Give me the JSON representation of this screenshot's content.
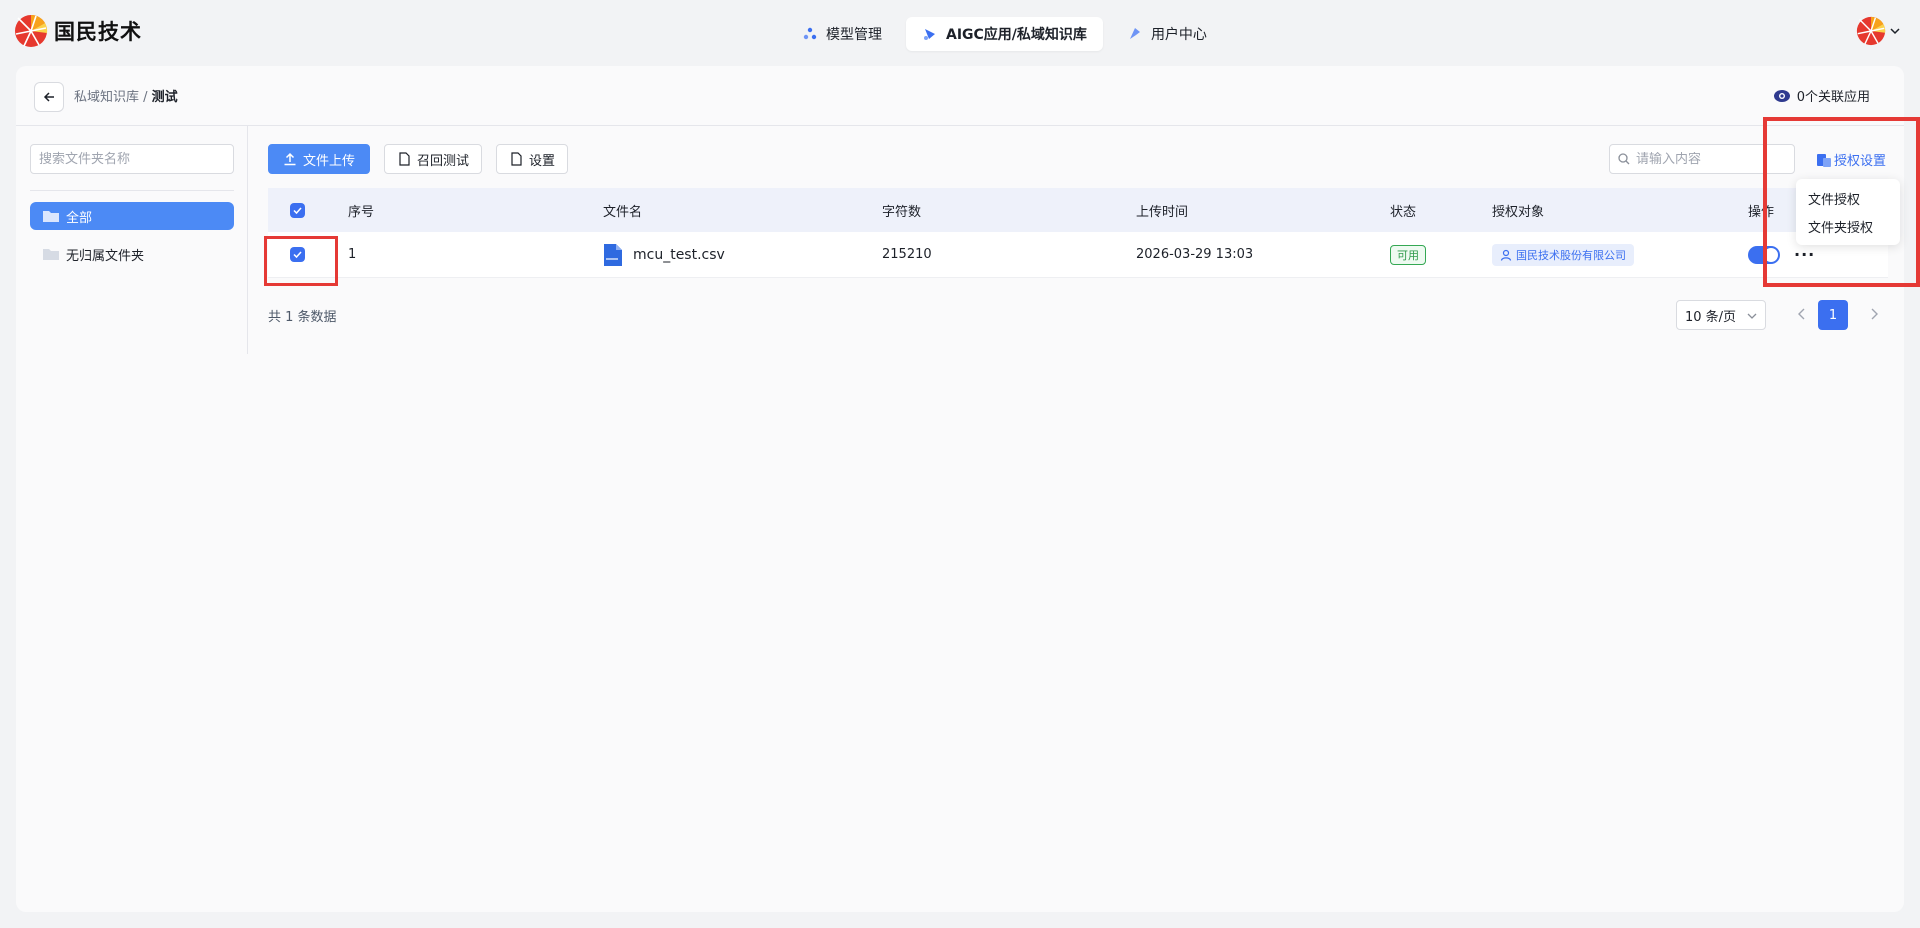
{
  "header": {
    "logo_text": "国民技术",
    "nav": [
      {
        "label": "模型管理",
        "active": false
      },
      {
        "label": "AIGC应用/私域知识库",
        "active": true
      },
      {
        "label": "用户中心",
        "active": false
      }
    ]
  },
  "breadcrumb": {
    "parent": "私域知识库 / ",
    "current": "测试"
  },
  "assoc_apps": "0个关联应用",
  "sidebar": {
    "search_placeholder": "搜索文件夹名称",
    "folders": [
      {
        "label": "全部",
        "active": true
      },
      {
        "label": "无归属文件夹",
        "active": false
      }
    ]
  },
  "toolbar": {
    "upload": "文件上传",
    "recall": "召回测试",
    "settings": "设置",
    "search_placeholder": "请输入内容",
    "auth": "授权设置"
  },
  "table": {
    "columns": [
      "序号",
      "文件名",
      "字符数",
      "上传时间",
      "状态",
      "授权对象",
      "操作"
    ],
    "rows": [
      {
        "index": "1",
        "filename": "mcu_test.csv",
        "chars": "215210",
        "uploaded": "2026-03-29 13:03",
        "status": "可用",
        "auth_target": "国民技术股份有限公司",
        "more": "···"
      }
    ]
  },
  "pagination": {
    "total": "共 1 条数据",
    "page_size": "10 条/页",
    "current": "1"
  },
  "dropdown": {
    "items": [
      "文件授权",
      "文件夹授权"
    ]
  },
  "colors": {
    "primary": "#3b6ff0",
    "sidebar_active": "#4c8af5",
    "highlight": "#e53935",
    "status_ok": "#34a853"
  },
  "icons": [
    "logo-icon",
    "model-icon",
    "aigc-icon",
    "user-center-icon",
    "back-arrow-icon",
    "eye-icon",
    "folder-icon",
    "upload-icon",
    "file-icon",
    "search-icon",
    "auth-icon",
    "user-icon",
    "chevron-down-icon",
    "chevron-left-icon",
    "chevron-right-icon",
    "check-icon"
  ]
}
